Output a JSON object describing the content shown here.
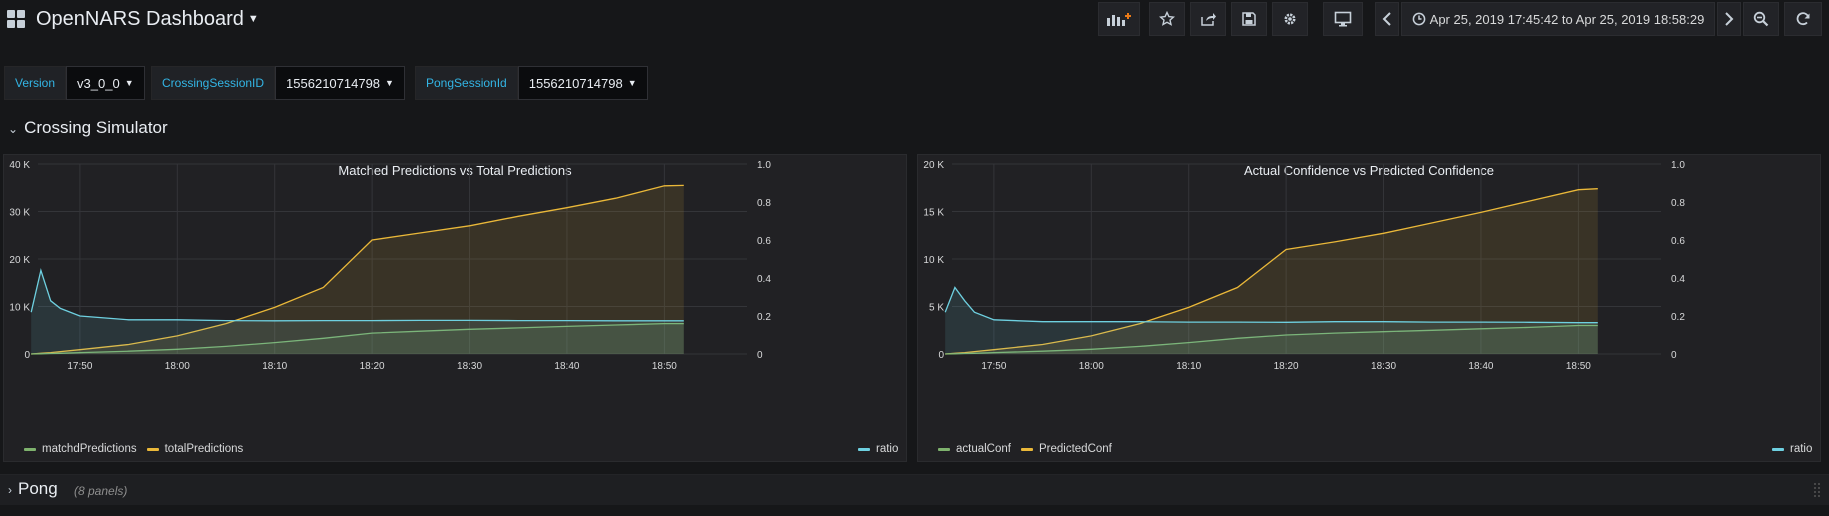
{
  "header": {
    "title": "OpenNARS Dashboard",
    "time_range": "Apr 25, 2019 17:45:42 to Apr 25, 2019 18:58:29",
    "buttons": [
      "add-panel",
      "star",
      "share",
      "save",
      "settings",
      "tv-mode",
      "time-back",
      "time-forward",
      "zoom-out",
      "refresh"
    ]
  },
  "variables": [
    {
      "label": "Version",
      "value": "v3_0_0"
    },
    {
      "label": "CrossingSessionID",
      "value": "1556210714798"
    },
    {
      "label": "PongSessionId",
      "value": "1556210714798"
    }
  ],
  "rows": {
    "crossing": {
      "title": "Crossing Simulator"
    },
    "pong": {
      "title": "Pong",
      "panel_count": "(8 panels)"
    }
  },
  "colors": {
    "green": "#7eb26d",
    "orange": "#eab839",
    "cyan": "#6ed0e0",
    "label_blue": "#33b5e5"
  },
  "chart_data": [
    {
      "type": "line",
      "title": "Matched Predictions vs Total Predictions",
      "x": [
        "17:45",
        "17:46",
        "17:47",
        "17:48",
        "17:50",
        "17:55",
        "18:00",
        "18:05",
        "18:10",
        "18:15",
        "18:20",
        "18:25",
        "18:30",
        "18:35",
        "18:40",
        "18:45",
        "18:50",
        "18:52"
      ],
      "xticks": [
        "17:50",
        "18:00",
        "18:10",
        "18:20",
        "18:30",
        "18:40",
        "18:50"
      ],
      "left_axis": {
        "ticks": [
          "0",
          "10 K",
          "20 K",
          "30 K",
          "40 K"
        ],
        "ylim": [
          0,
          40000
        ]
      },
      "right_axis": {
        "ticks": [
          "0",
          "0.2",
          "0.4",
          "0.6",
          "0.8",
          "1.0"
        ],
        "ylim": [
          0,
          1.0
        ]
      },
      "series": [
        {
          "name": "matchdPredictions",
          "axis": "left",
          "color": "#7eb26d",
          "values": [
            0,
            50,
            100,
            150,
            300,
            600,
            1000,
            1600,
            2400,
            3300,
            4400,
            4800,
            5200,
            5500,
            5800,
            6100,
            6400,
            6400
          ]
        },
        {
          "name": "totalPredictions",
          "axis": "left",
          "color": "#eab839",
          "values": [
            0,
            150,
            300,
            500,
            900,
            2000,
            3800,
            6400,
            9800,
            14000,
            24000,
            25500,
            27000,
            29000,
            30800,
            32800,
            35400,
            35500
          ]
        },
        {
          "name": "ratio",
          "axis": "right",
          "color": "#6ed0e0",
          "values": [
            0.22,
            0.44,
            0.28,
            0.24,
            0.2,
            0.18,
            0.18,
            0.176,
            0.175,
            0.176,
            0.176,
            0.177,
            0.177,
            0.176,
            0.176,
            0.175,
            0.175,
            0.175
          ]
        }
      ]
    },
    {
      "type": "line",
      "title": "Actual Confidence vs Predicted Confidence",
      "x": [
        "17:45",
        "17:46",
        "17:47",
        "17:48",
        "17:50",
        "17:55",
        "18:00",
        "18:05",
        "18:10",
        "18:15",
        "18:20",
        "18:25",
        "18:30",
        "18:35",
        "18:40",
        "18:45",
        "18:50",
        "18:52"
      ],
      "xticks": [
        "17:50",
        "18:00",
        "18:10",
        "18:20",
        "18:30",
        "18:40",
        "18:50"
      ],
      "left_axis": {
        "ticks": [
          "0",
          "5 K",
          "10 K",
          "15 K",
          "20 K"
        ],
        "ylim": [
          0,
          20000
        ]
      },
      "right_axis": {
        "ticks": [
          "0",
          "0.2",
          "0.4",
          "0.6",
          "0.8",
          "1.0"
        ],
        "ylim": [
          0,
          1.0
        ]
      },
      "series": [
        {
          "name": "actualConf",
          "axis": "left",
          "color": "#7eb26d",
          "values": [
            0,
            25,
            50,
            75,
            150,
            300,
            500,
            800,
            1200,
            1650,
            2000,
            2200,
            2350,
            2500,
            2650,
            2800,
            3000,
            3000
          ]
        },
        {
          "name": "PredictedConf",
          "axis": "left",
          "color": "#eab839",
          "values": [
            0,
            75,
            150,
            250,
            450,
            1000,
            1900,
            3200,
            4900,
            7000,
            11000,
            11800,
            12700,
            13800,
            14900,
            16100,
            17300,
            17400
          ]
        },
        {
          "name": "ratio",
          "axis": "right",
          "color": "#6ed0e0",
          "values": [
            0.22,
            0.35,
            0.28,
            0.22,
            0.18,
            0.17,
            0.17,
            0.17,
            0.168,
            0.168,
            0.167,
            0.17,
            0.17,
            0.168,
            0.168,
            0.167,
            0.165,
            0.165
          ]
        }
      ]
    }
  ]
}
